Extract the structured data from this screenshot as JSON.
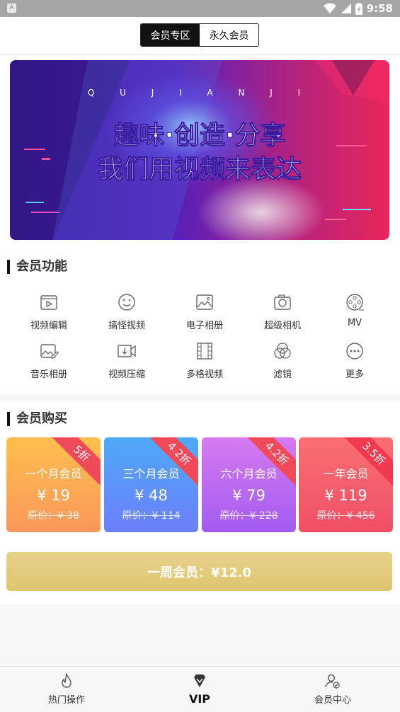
{
  "status_bar": {
    "time": "9:58",
    "app_letter": "A"
  },
  "header": {
    "tabs": [
      "会员专区",
      "永久会员"
    ],
    "active_tab": 0
  },
  "banner": {
    "letters": "Q U J I A N J I",
    "line1": "趣味·创造·分享",
    "line2": "我们用视频来表达"
  },
  "features": {
    "title": "会员功能",
    "items": [
      {
        "label": "视频编辑",
        "icon": "video-edit-icon"
      },
      {
        "label": "搞怪视频",
        "icon": "smiley-icon"
      },
      {
        "label": "电子相册",
        "icon": "image-icon"
      },
      {
        "label": "超级相机",
        "icon": "camera-icon"
      },
      {
        "label": "MV",
        "icon": "film-reel-icon"
      },
      {
        "label": "音乐相册",
        "icon": "image-edit-icon"
      },
      {
        "label": "视频压缩",
        "icon": "compress-icon"
      },
      {
        "label": "多格视频",
        "icon": "film-strip-icon"
      },
      {
        "label": "滤镜",
        "icon": "filter-icon"
      },
      {
        "label": "更多",
        "icon": "more-icon"
      }
    ]
  },
  "purchase": {
    "title": "会员购买",
    "plans": [
      {
        "name": "一个月会员",
        "price": "¥ 19",
        "original": "原价：¥ 38",
        "discount": "5折",
        "color_top": "#ffbf4d",
        "color_bottom": "#f9975a"
      },
      {
        "name": "三个月会员",
        "price": "¥ 48",
        "original": "原价：¥ 114",
        "discount": "4.2折",
        "color_top": "#4fa9f9",
        "color_bottom": "#6c7ffb"
      },
      {
        "name": "六个月会员",
        "price": "¥ 79",
        "original": "原价：¥ 228",
        "discount": "4.2折",
        "color_top": "#d77af0",
        "color_bottom": "#a25cf1"
      },
      {
        "name": "一年会员",
        "price": "¥ 119",
        "original": "原价：¥ 456",
        "discount": "3.5折",
        "color_top": "#fb6f72",
        "color_bottom": "#ef4f66"
      }
    ],
    "week_button": "一周会员：¥12.0"
  },
  "tabbar": {
    "items": [
      {
        "label": "热门操作",
        "icon": "flame-icon"
      },
      {
        "label": "VIP",
        "icon": "diamond-icon"
      },
      {
        "label": "会员中心",
        "icon": "user-check-icon"
      }
    ],
    "active": 1
  }
}
